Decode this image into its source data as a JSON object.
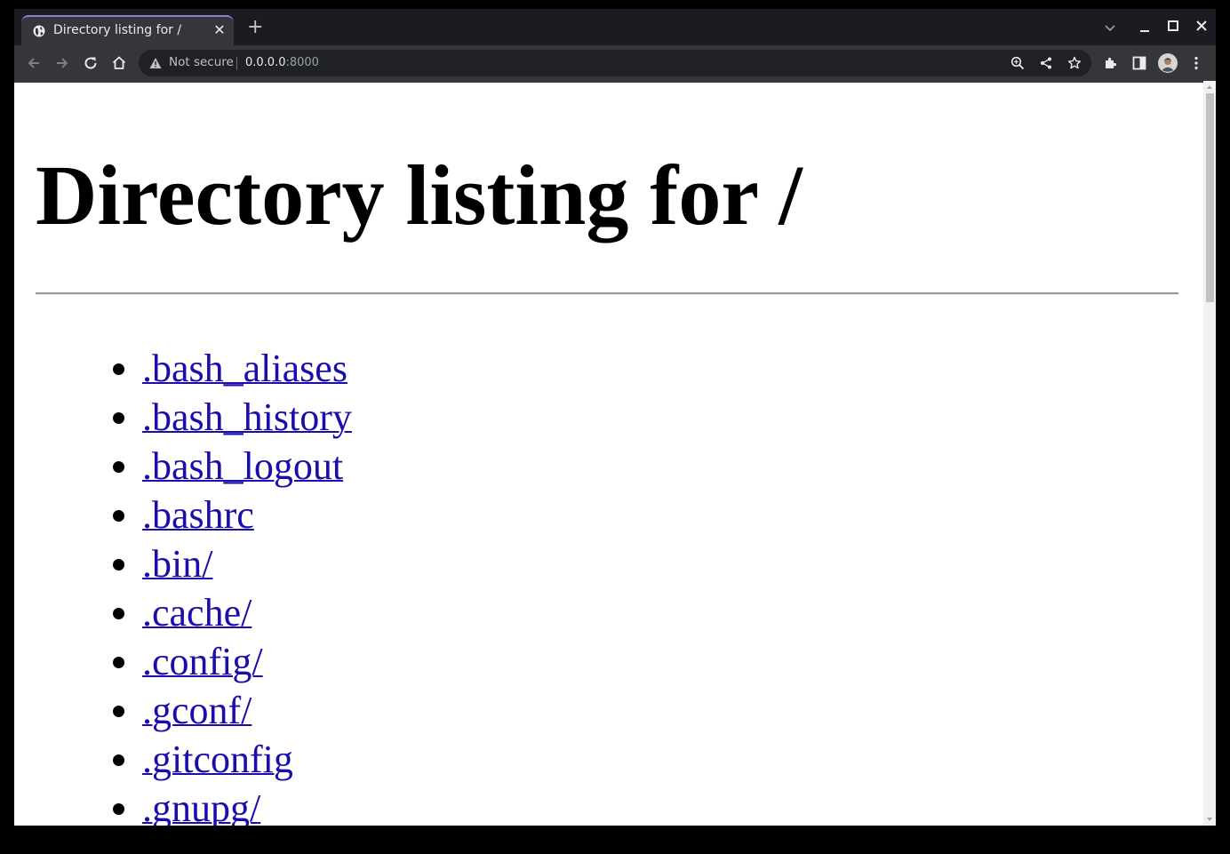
{
  "browser": {
    "tab_title": "Directory listing for /",
    "address": {
      "security_label": "Not secure",
      "host": "0.0.0.0",
      "port": ":8000"
    }
  },
  "page": {
    "heading": "Directory listing for /",
    "entries": [
      ".bash_aliases",
      ".bash_history",
      ".bash_logout",
      ".bashrc",
      ".bin/",
      ".cache/",
      ".config/",
      ".gconf/",
      ".gitconfig",
      ".gnupg/"
    ]
  },
  "colors": {
    "link": "#1a0dab",
    "tab_accent": "#8c7fd0",
    "toolbar": "#35363a",
    "frame": "#1c1b22"
  },
  "icons": {
    "tab": "globe-icon",
    "toolbar": [
      "back-icon",
      "forward-icon",
      "reload-icon",
      "home-icon"
    ],
    "omnibox": [
      "warning-icon",
      "zoom-icon",
      "share-icon",
      "bookmark-star-icon"
    ],
    "right": [
      "extensions-icon",
      "side-panel-icon",
      "profile-avatar",
      "menu-icon"
    ]
  }
}
